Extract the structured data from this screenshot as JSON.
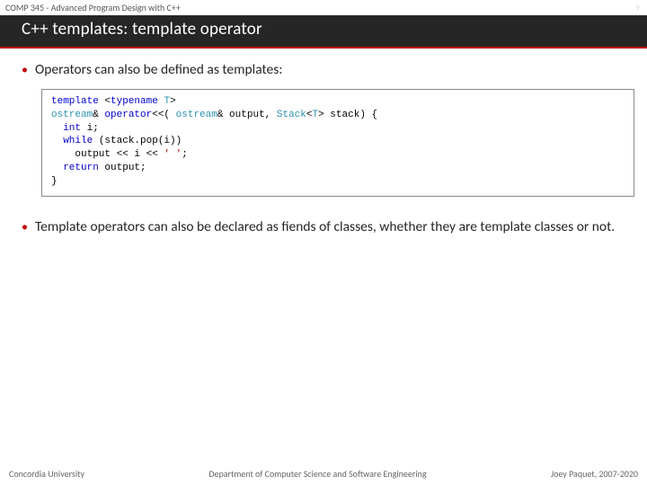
{
  "header": {
    "course": "COMP 345 - Advanced Program Design with C++",
    "page_number": "9"
  },
  "title": "C++ templates: template operator",
  "bullets": [
    "Operators can also be defined as templates:",
    "Template operators can also be declared as fiends of classes, whether they are template classes or not."
  ],
  "code": {
    "tokens": [
      {
        "t": "template ",
        "c": "kw"
      },
      {
        "t": "<",
        "c": ""
      },
      {
        "t": "typename ",
        "c": "kw"
      },
      {
        "t": "T",
        "c": "typ"
      },
      {
        "t": ">",
        "c": ""
      },
      {
        "t": "\n",
        "c": ""
      },
      {
        "t": "ostream",
        "c": "typ"
      },
      {
        "t": "& ",
        "c": ""
      },
      {
        "t": "operator",
        "c": "kw"
      },
      {
        "t": "<<( ",
        "c": ""
      },
      {
        "t": "ostream",
        "c": "typ"
      },
      {
        "t": "& output, ",
        "c": ""
      },
      {
        "t": "Stack",
        "c": "typ"
      },
      {
        "t": "<",
        "c": ""
      },
      {
        "t": "T",
        "c": "typ"
      },
      {
        "t": "> stack) {",
        "c": ""
      },
      {
        "t": "\n",
        "c": ""
      },
      {
        "t": "  ",
        "c": ""
      },
      {
        "t": "int ",
        "c": "kw"
      },
      {
        "t": "i;",
        "c": ""
      },
      {
        "t": "\n",
        "c": ""
      },
      {
        "t": "  ",
        "c": ""
      },
      {
        "t": "while ",
        "c": "kw"
      },
      {
        "t": "(stack.pop(i))",
        "c": ""
      },
      {
        "t": "\n",
        "c": ""
      },
      {
        "t": "    output << i << ",
        "c": ""
      },
      {
        "t": "' '",
        "c": "str"
      },
      {
        "t": ";",
        "c": ""
      },
      {
        "t": "\n",
        "c": ""
      },
      {
        "t": "  ",
        "c": ""
      },
      {
        "t": "return ",
        "c": "kw"
      },
      {
        "t": "output;",
        "c": ""
      },
      {
        "t": "\n",
        "c": ""
      },
      {
        "t": "}",
        "c": ""
      }
    ]
  },
  "footer": {
    "left": "Concordia University",
    "center": "Department of Computer Science and Software Engineering",
    "right": "Joey Paquet, 2007-2020"
  }
}
